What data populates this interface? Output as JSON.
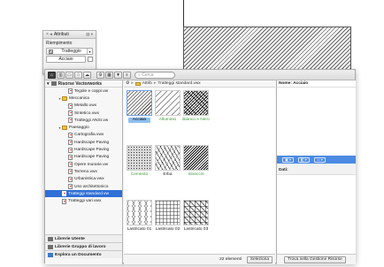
{
  "attributes_panel": {
    "title": "Attributi",
    "section_label": "Riempimento",
    "fill_type": "Tratteggio",
    "fill_name": "Acciaio"
  },
  "toolbar": {
    "search_placeholder": "Cerca"
  },
  "library_tree": {
    "root_label": "Risorse Vectorworks",
    "items": [
      {
        "label": "Tegole e coppi.vw",
        "kind": "file",
        "indent": 3,
        "selected": false
      },
      {
        "label": "Meccanica",
        "kind": "folder",
        "indent": 2,
        "selected": false
      },
      {
        "label": "Metallo.vwx",
        "kind": "file",
        "indent": 3,
        "selected": false
      },
      {
        "label": "Sintetico.vwx",
        "kind": "file",
        "indent": 3,
        "selected": false
      },
      {
        "label": "Tratteggi ANSI.vw",
        "kind": "file",
        "indent": 3,
        "selected": false
      },
      {
        "label": "Paesaggio",
        "kind": "folder",
        "indent": 2,
        "selected": false
      },
      {
        "label": "Cartografia.vwx",
        "kind": "file",
        "indent": 3,
        "selected": false
      },
      {
        "label": "Hardscape Paving",
        "kind": "file",
        "indent": 3,
        "selected": false
      },
      {
        "label": "Hardscape Paving",
        "kind": "file",
        "indent": 3,
        "selected": false
      },
      {
        "label": "Hardscape Paving",
        "kind": "file",
        "indent": 3,
        "selected": false
      },
      {
        "label": "Opere murarie.vw",
        "kind": "file",
        "indent": 3,
        "selected": false
      },
      {
        "label": "Terreno.vwx",
        "kind": "file",
        "indent": 3,
        "selected": false
      },
      {
        "label": "Urbanistica.vwx",
        "kind": "file",
        "indent": 3,
        "selected": false
      },
      {
        "label": "Uso architettonico",
        "kind": "file",
        "indent": 3,
        "selected": false
      },
      {
        "label": "Tratteggi standard.vw",
        "kind": "file",
        "indent": 2,
        "selected": true
      },
      {
        "label": "Tratteggi vari.vwx",
        "kind": "file",
        "indent": 2,
        "selected": false
      }
    ],
    "libraries": [
      "Librerie Utente",
      "Librerie Gruppo di lavoro",
      "Esplora un Documento"
    ]
  },
  "breadcrumb": [
    "Attrib",
    "Tratteggi standard.vwx"
  ],
  "resources": [
    {
      "label": "Acciaio",
      "pattern": "t-hatch",
      "color": "normal",
      "selected": true
    },
    {
      "label": "Alluminio",
      "pattern": "t-hatch2",
      "color": "green",
      "selected": false
    },
    {
      "label": "Bianco e Nero",
      "pattern": "t-bianco",
      "color": "green",
      "selected": false
    },
    {
      "label": "Cemento",
      "pattern": "t-cemento",
      "color": "green",
      "selected": false
    },
    {
      "label": "Erba",
      "pattern": "t-erba",
      "color": "normal",
      "selected": false
    },
    {
      "label": "Intreccio",
      "pattern": "t-intreccio",
      "color": "green",
      "selected": false
    },
    {
      "label": "Lastricato 01",
      "pattern": "t-lastr1",
      "color": "normal",
      "selected": false
    },
    {
      "label": "Lastricato 02",
      "pattern": "t-lastr2",
      "color": "normal",
      "selected": false
    },
    {
      "label": "Lastricato 03",
      "pattern": "t-lastr3",
      "color": "normal",
      "selected": false
    }
  ],
  "status": {
    "count": "22 elementi",
    "select_label": "Seleziona",
    "find_label": "Trova nella Gestione Risorse"
  },
  "detail": {
    "name_label": "Nome: Acciaio",
    "data_label": "Dati:"
  },
  "colors": {
    "accent": "#2f6fd6",
    "preview_bar": "#4b8be3",
    "green_label": "#3a9b3a"
  }
}
